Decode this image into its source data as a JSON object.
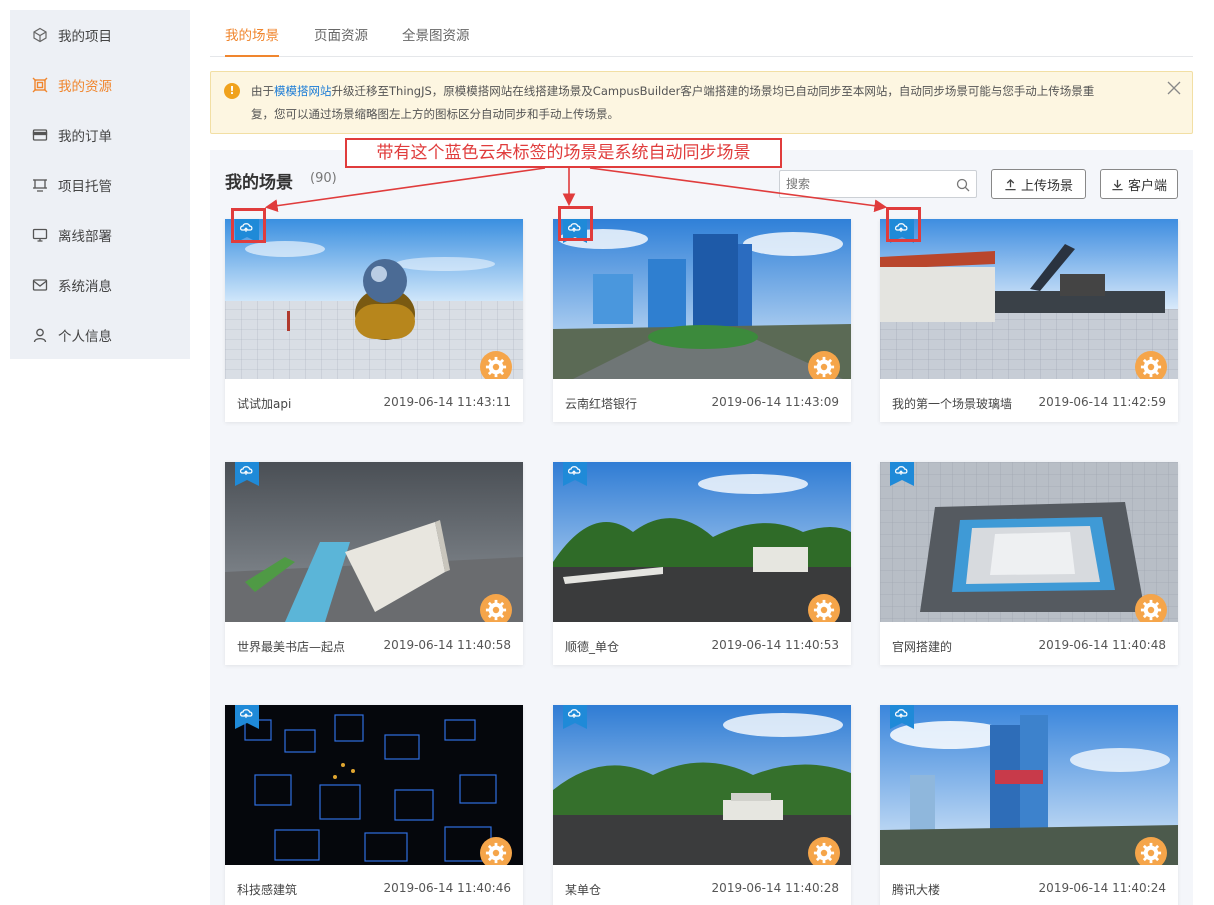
{
  "sidebar": {
    "items": [
      {
        "label": "我的项目",
        "icon": "cube-icon",
        "active": false
      },
      {
        "label": "我的资源",
        "icon": "resource-frame-icon",
        "active": true
      },
      {
        "label": "我的订单",
        "icon": "card-icon",
        "active": false
      },
      {
        "label": "项目托管",
        "icon": "hosting-icon",
        "active": false
      },
      {
        "label": "离线部署",
        "icon": "monitor-icon",
        "active": false
      },
      {
        "label": "系统消息",
        "icon": "mail-icon",
        "active": false
      },
      {
        "label": "个人信息",
        "icon": "user-icon",
        "active": false
      }
    ]
  },
  "tabs": [
    {
      "label": "我的场景",
      "active": true
    },
    {
      "label": "页面资源",
      "active": false
    },
    {
      "label": "全景图资源",
      "active": false
    }
  ],
  "notice": {
    "prefix": "由于",
    "link": "模模搭网站",
    "line1_rest": "升级迁移至ThingJS，原模模搭网站在线搭建场景及CampusBuilder客户端搭建的场景均已自动同步至本网站，自动同步场景可能与您手动上传场景重",
    "line2": "复，您可以通过场景缩略图左上方的图标区分自动同步和手动上传场景。"
  },
  "panel": {
    "title": "我的场景",
    "count": "(90)",
    "search_placeholder": "搜索",
    "upload_label": "上传场景",
    "client_label": "客户端"
  },
  "annotation": {
    "text": "带有这个蓝色云朵标签的场景是系统自动同步场景",
    "color": "#e03c3c"
  },
  "scenes": [
    {
      "name": "试试加api",
      "time": "2019-06-14 11:43:11",
      "thumb": "globe-scene"
    },
    {
      "name": "云南红塔银行",
      "time": "2019-06-14 11:43:09",
      "thumb": "tower-scene"
    },
    {
      "name": "我的第一个场景玻璃墙",
      "time": "2019-06-14 11:42:59",
      "thumb": "crane-scene"
    },
    {
      "name": "世界最美书店—起点",
      "time": "2019-06-14 11:40:58",
      "thumb": "bookstore-scene"
    },
    {
      "name": "顺德_单仓",
      "time": "2019-06-14 11:40:53",
      "thumb": "park-scene"
    },
    {
      "name": "官网搭建的",
      "time": "2019-06-14 11:40:48",
      "thumb": "room-scene"
    },
    {
      "name": "科技感建筑",
      "time": "2019-06-14 11:40:46",
      "thumb": "tech-scene"
    },
    {
      "name": "某单仓",
      "time": "2019-06-14 11:40:28",
      "thumb": "warehouse-scene"
    },
    {
      "name": "腾讯大楼",
      "time": "2019-06-14 11:40:24",
      "thumb": "tencent-scene"
    }
  ],
  "colors": {
    "accent": "#f0862e",
    "cloud_tag": "#1f8ad8",
    "gear_bg": "#f5a54a",
    "notice_bg": "#fdf6e1"
  }
}
